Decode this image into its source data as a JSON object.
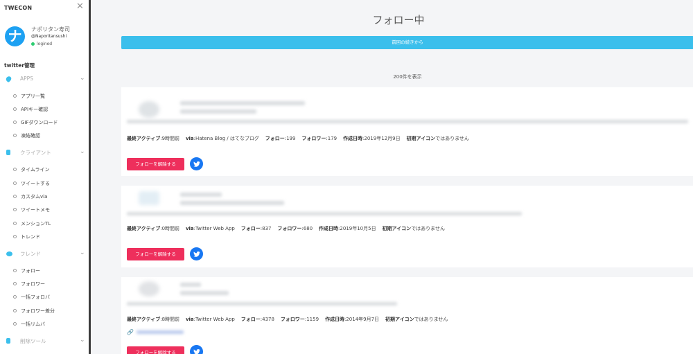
{
  "sidebar": {
    "brand": "TWECON",
    "close_symbol": "✕",
    "user": {
      "avatar_glyph": "ナ",
      "name": "ナポリタン寿司",
      "handle": "@Naporitansushi",
      "status": "logined",
      "status_color": "#2ecc71"
    },
    "section_title": "twitter管理",
    "groups": [
      {
        "label": "APPS",
        "icon": "rocket-icon",
        "color": "#3bbfec",
        "items": [
          "アプリ一覧",
          "APIキー確認",
          "GIFダウンロード",
          "凍結確認"
        ]
      },
      {
        "label": "クライアント",
        "icon": "phone-icon",
        "color": "#3bbfec",
        "items": [
          "タイムライン",
          "ツイートする",
          "カスタムvia",
          "ツイートメモ",
          "メンションTL",
          "トレンド"
        ]
      },
      {
        "label": "フレンド",
        "icon": "users-icon",
        "color": "#3bbfec",
        "items": [
          "フォロー",
          "フォロワー",
          "一括フォロバ",
          "フォロワー差分",
          "一括リムバ"
        ]
      },
      {
        "label": "削除ツール",
        "icon": "trash-icon",
        "color": "#3bbfec",
        "items": []
      }
    ]
  },
  "main": {
    "title": "フォロー中",
    "resume_button": "前回の続きから",
    "count_text": "200件を表示",
    "labels": {
      "last_active": "最終アクティブ",
      "via": "via",
      "follow": "フォロー",
      "follower": "フォロワー",
      "created": "作成日時",
      "default_icon": "初期アイコン",
      "default_icon_suffix": "ではありません",
      "unfollow": "フォローを解除する"
    },
    "cards": [
      {
        "last_active": ":9時間前",
        "via": ":Hatena Blog / はてなブログ",
        "follow": ":199",
        "follower": ":179",
        "created": ":2019年12月9日"
      },
      {
        "last_active": ":0時間前",
        "via": ":Twitter Web App",
        "follow": ":837",
        "follower": ":680",
        "created": ":2019年10月5日"
      },
      {
        "last_active": ":8時間前",
        "via": ":Twitter Web App",
        "follow": ":4378",
        "follower": ":1159",
        "created": ":2014年9月7日"
      }
    ],
    "colors": {
      "accent": "#3bbfec",
      "danger": "#ee2f5c",
      "twitter": "#1877f2"
    }
  }
}
